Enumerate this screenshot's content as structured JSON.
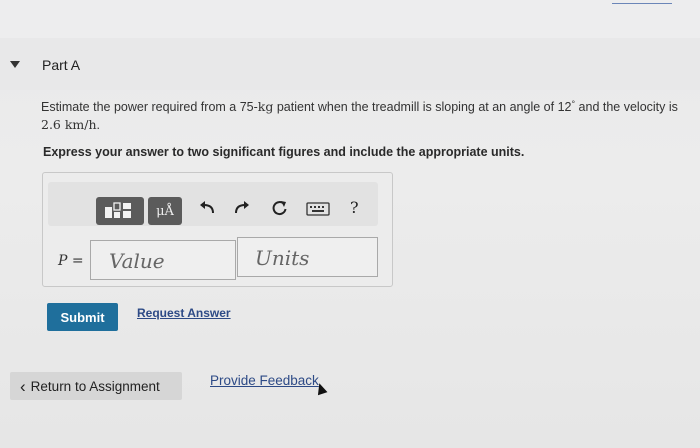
{
  "part": {
    "label": "Part A"
  },
  "question": {
    "text_before_mass": "Estimate the power required from a 75-",
    "mass_unit": "kg",
    "text_after_mass": " patient when the treadmill is sloping at an angle of 12",
    "degree_symbol": "°",
    "text_after_angle": " and the velocity is",
    "velocity": "2.6 km/h",
    "period": "."
  },
  "instruction": "Express your answer to two significant figures and include the appropriate units.",
  "toolbar": {
    "units_label": "μÅ",
    "help_label": "?",
    "icons": [
      "templates-icon",
      "units-icon",
      "undo-icon",
      "redo-icon",
      "reset-icon",
      "keyboard-icon",
      "help-icon"
    ]
  },
  "answer": {
    "variable_label": "P =",
    "value_placeholder": "Value",
    "units_placeholder": "Units"
  },
  "actions": {
    "submit_label": "Submit",
    "request_answer_label": "Request Answer",
    "return_label": "Return to Assignment",
    "feedback_label": "Provide Feedback"
  },
  "colors": {
    "submit_bg": "#1f6f9c",
    "link": "#2d4a86",
    "toolbar_button": "#5b5b5b"
  }
}
